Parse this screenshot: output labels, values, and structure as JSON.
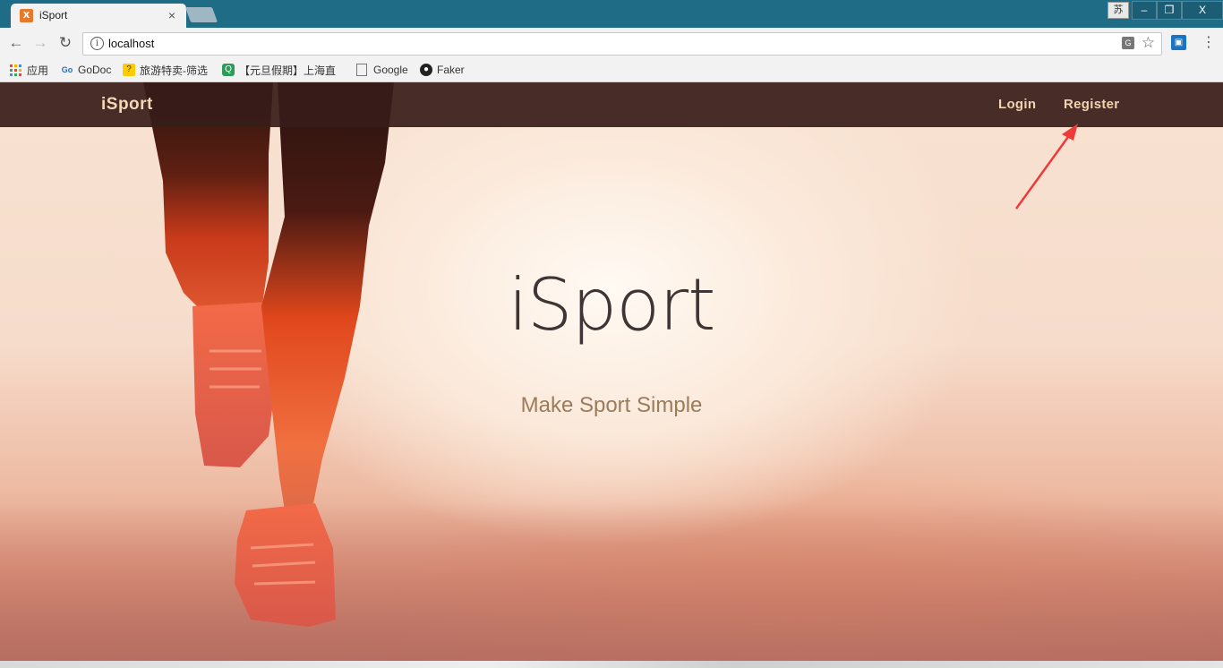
{
  "browser": {
    "tab_title": "iSport",
    "tab_favicon": "X",
    "tab_close": "×",
    "address": "localhost",
    "ime_label": "苏",
    "window_controls": {
      "minimize": "–",
      "restore": "❐",
      "close": "X"
    },
    "bookmarks": [
      {
        "label": "应用",
        "icon": "apps-grid-icon"
      },
      {
        "label": "GoDoc",
        "icon": "godoc-icon"
      },
      {
        "label": "旅游特卖-筛选",
        "icon": "travel-icon"
      },
      {
        "label": "【元旦假期】上海直",
        "icon": "q-icon"
      },
      {
        "label": "Google",
        "icon": "page-icon"
      },
      {
        "label": "Faker",
        "icon": "github-icon"
      }
    ]
  },
  "site": {
    "brand": "iSport",
    "nav": {
      "login": "Login",
      "register": "Register"
    },
    "hero": {
      "title": "iSport",
      "subtitle": "Make Sport Simple"
    }
  },
  "colors": {
    "navbar": "#3a1d1a",
    "nav_text": "#f1d3af",
    "annotation_arrow": "#ee3a3a"
  }
}
